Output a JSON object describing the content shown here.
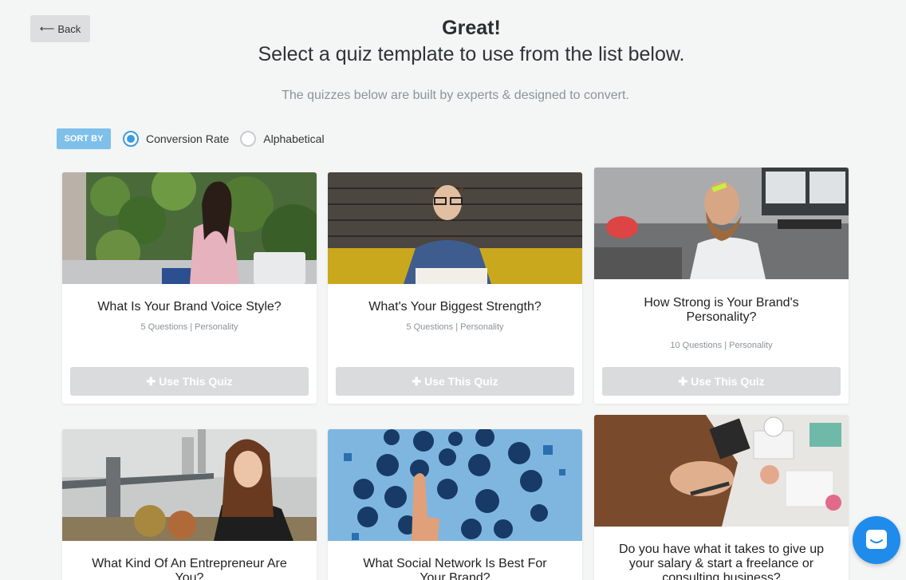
{
  "back": {
    "label": "Back"
  },
  "header": {
    "title": "Great!",
    "subtitle": "Select a quiz template to use from the list below.",
    "tagline": "The quizzes below are built by experts & designed to convert."
  },
  "sort": {
    "badge": "SORT BY",
    "options": [
      {
        "label": "Conversion Rate",
        "selected": true
      },
      {
        "label": "Alphabetical",
        "selected": false
      }
    ]
  },
  "cards": [
    {
      "title": "What Is Your Brand Voice Style?",
      "meta": "5 Questions | Personality",
      "button": "Use This Quiz"
    },
    {
      "title": "What's Your Biggest Strength?",
      "meta": "5 Questions | Personality",
      "button": "Use This Quiz"
    },
    {
      "title": "How Strong is Your Brand's Personality?",
      "meta": "10 Questions | Personality",
      "button": "Use This Quiz"
    },
    {
      "title": "What Kind Of An Entrepreneur Are You?"
    },
    {
      "title": "What Social Network Is Best For Your Brand?"
    },
    {
      "title": "Do you have what it takes to give up your salary & start a freelance or consulting business?"
    }
  ],
  "colors": {
    "accent": "#3d9be0",
    "sort_badge": "#7ec0ea",
    "chat": "#1f8ceb"
  }
}
